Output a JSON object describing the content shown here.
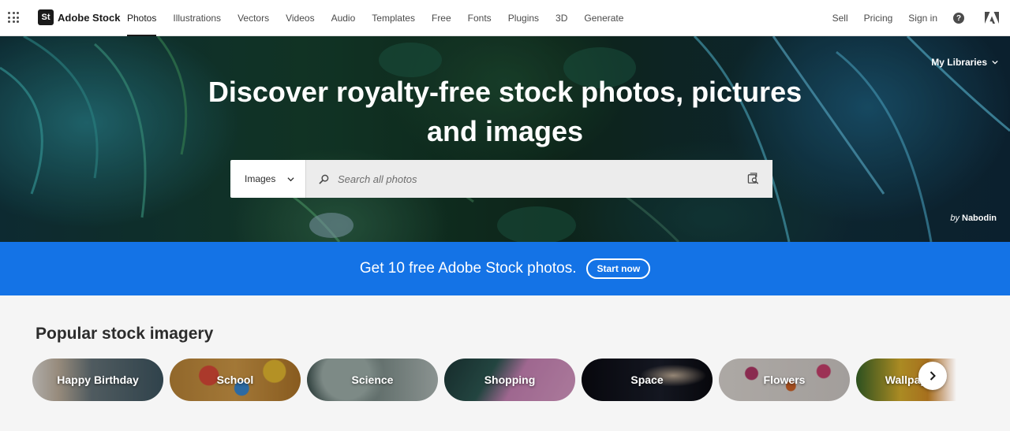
{
  "brand": {
    "badge": "St",
    "name": "Adobe Stock"
  },
  "nav": {
    "links": [
      {
        "label": "Photos",
        "active": true
      },
      {
        "label": "Illustrations"
      },
      {
        "label": "Vectors"
      },
      {
        "label": "Videos"
      },
      {
        "label": "Audio"
      },
      {
        "label": "Templates"
      },
      {
        "label": "Free"
      },
      {
        "label": "Fonts"
      },
      {
        "label": "Plugins"
      },
      {
        "label": "3D"
      },
      {
        "label": "Generate"
      }
    ],
    "right": {
      "sell": "Sell",
      "pricing": "Pricing",
      "sign_in": "Sign in",
      "help_glyph": "?"
    }
  },
  "hero": {
    "title": "Discover royalty-free stock photos, pictures and images",
    "my_libraries": "My Libraries",
    "credit_by": "by",
    "credit_author": "Nabodin"
  },
  "search": {
    "type_selected": "Images",
    "placeholder": "Search all photos",
    "icons": [
      "search-icon",
      "visual-search-icon",
      "chevron-down-icon"
    ]
  },
  "promo": {
    "text": "Get 10 free Adobe Stock photos.",
    "button": "Start now"
  },
  "popular": {
    "title": "Popular stock imagery",
    "categories": [
      "Happy Birthday",
      "School",
      "Science",
      "Shopping",
      "Space",
      "Flowers",
      "Wallpaper"
    ]
  },
  "colors": {
    "promo_blue": "#1473e6",
    "nav_active": "#1a1a1a",
    "text_primary": "#2c2c2c"
  }
}
